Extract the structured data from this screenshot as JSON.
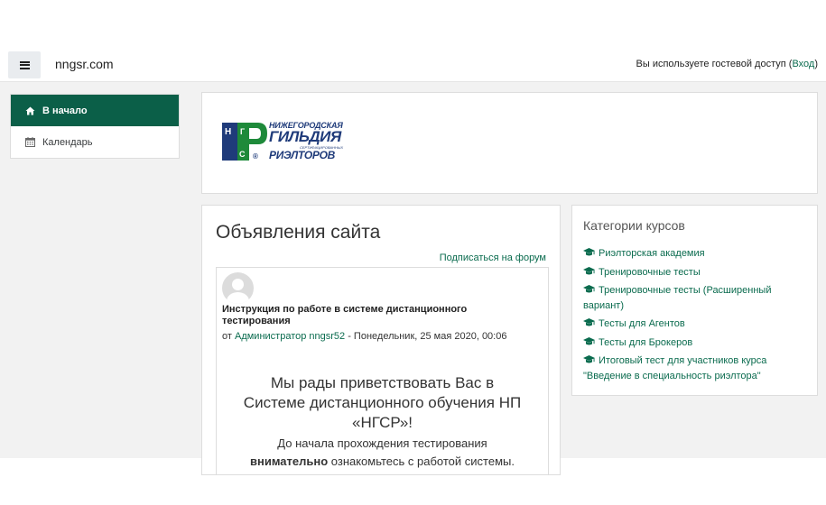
{
  "header": {
    "site_name": "nngsr.com",
    "guest_text": "Вы используете гостевой доступ (",
    "login_label": "Вход",
    "guest_close": ")"
  },
  "drawer": {
    "items": [
      {
        "label": "В начало",
        "icon": "home-icon",
        "active": true
      },
      {
        "label": "Календарь",
        "icon": "calendar-icon",
        "active": false
      }
    ]
  },
  "logo": {
    "line1": "НИЖЕГОРОДСКАЯ",
    "line2": "ГИЛЬДИЯ",
    "line3": "СЕРТИФИЦИРОВАННЫХ",
    "line4": "РИЭЛТОРОВ",
    "mark_letters": [
      "Н",
      "Г",
      "С",
      "Р"
    ],
    "registered": "®"
  },
  "news": {
    "title": "Объявления сайта",
    "subscribe_label": "Подписаться на форум",
    "post": {
      "subject": "Инструкция по работе в системе дистанционного тестирования",
      "by": "от ",
      "author": "Администратор nngsr52",
      "date": " - Понедельник, 25 мая 2020, 00:06",
      "body_line1": "Мы рады приветствовать Вас в",
      "body_line2": "Системе дистанционного обучения НП «НГСР»!",
      "body_line3": "До начала прохождения тестирования",
      "body_line4_bold": "внимательно",
      "body_line4_rest": " ознакомьтесь с работой системы."
    }
  },
  "categories": {
    "title": "Категории курсов",
    "items": [
      "Риэлторская академия",
      "Тренировочные тесты",
      "Тренировочные тесты (Расширенный вариант)",
      "Тесты для Агентов",
      "Тесты для Брокеров",
      "Итоговый тест для участников курса \"Введение в специальность риэлтора\""
    ]
  },
  "colors": {
    "brand": "#0b5f48",
    "link": "#0a6b4e",
    "logo_blue": "#1f3b7a",
    "logo_green": "#1e8a3a"
  }
}
